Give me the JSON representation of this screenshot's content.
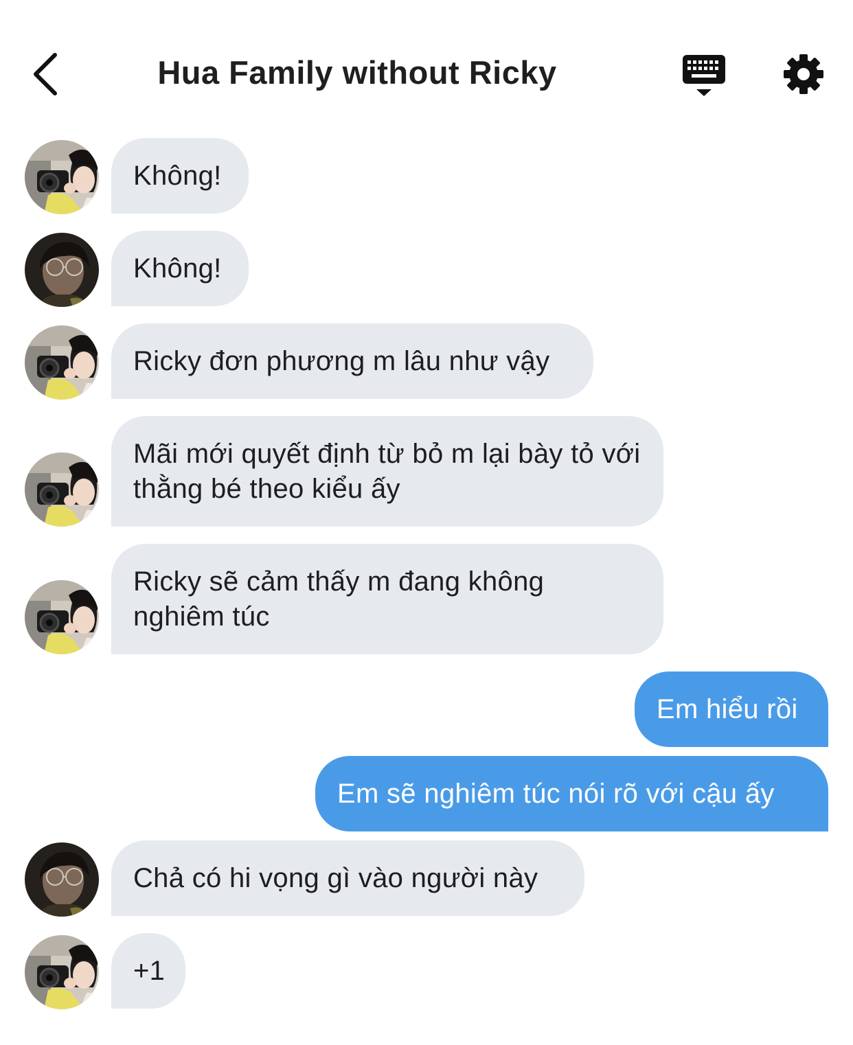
{
  "header": {
    "title": "Hua Family without Ricky",
    "back_icon": "chevron-left-icon",
    "keyboard_icon": "keyboard-icon",
    "settings_icon": "gear-icon"
  },
  "colors": {
    "incoming_bubble": "#e6e9ee",
    "outgoing_bubble": "#4a9be7",
    "text": "#1c1e21"
  },
  "messages": [
    {
      "direction": "in",
      "sender": "member-camera",
      "text": "Không!"
    },
    {
      "direction": "in",
      "sender": "member-glasses",
      "text": "Không!"
    },
    {
      "direction": "in",
      "sender": "member-camera",
      "text": "Ricky đơn phương m lâu như vậy"
    },
    {
      "direction": "in",
      "sender": "member-camera",
      "text": "Mãi mới quyết định từ bỏ m lại bày tỏ với thằng bé theo kiểu ấy"
    },
    {
      "direction": "in",
      "sender": "member-camera",
      "text": "Ricky sẽ cảm thấy m đang không nghiêm túc"
    },
    {
      "direction": "out",
      "sender": "me",
      "text": "Em hiểu rồi"
    },
    {
      "direction": "out",
      "sender": "me",
      "text": "Em sẽ nghiêm túc nói rõ với cậu ấy"
    },
    {
      "direction": "in",
      "sender": "member-glasses",
      "text": "Chả có hi vọng gì vào người này"
    },
    {
      "direction": "in",
      "sender": "member-camera",
      "text": "+1"
    }
  ]
}
